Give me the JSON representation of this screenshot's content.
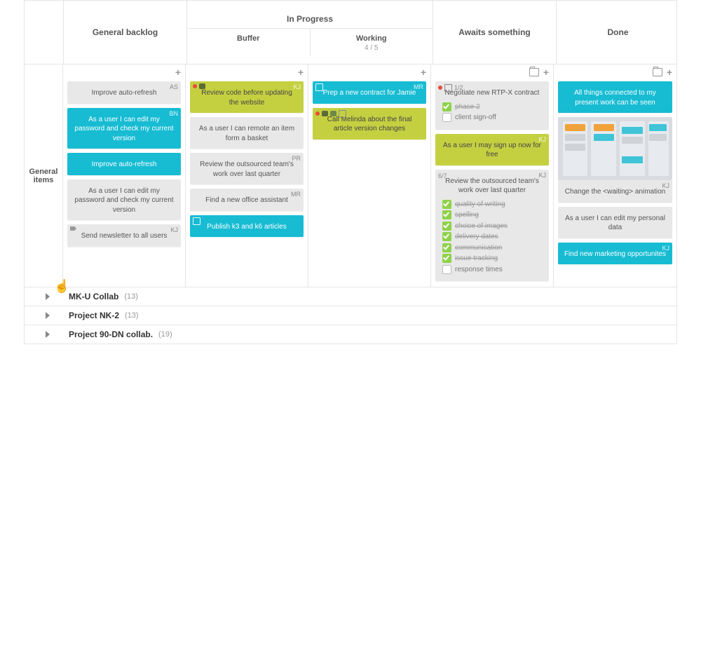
{
  "columns": {
    "backlog": "General backlog",
    "inprogress": "In Progress",
    "buffer": "Buffer",
    "working": "Working",
    "working_limit": "4 / 5",
    "awaits": "Awaits something",
    "done": "Done"
  },
  "row_label": "General items",
  "backlog": {
    "c1": {
      "assignee": "AS",
      "text": "Improve auto-refresh"
    },
    "c2": {
      "assignee": "BN",
      "text": "As a user I can edit my password and check my current version"
    },
    "c3": {
      "text": "Improve auto-refresh"
    },
    "c4": {
      "text": "As a user I can edit my password and check my current version"
    },
    "c5": {
      "assignee": "KJ",
      "text": "Send newsletter to all users"
    }
  },
  "buffer": {
    "c1": {
      "assignee": "KJ",
      "text": "Review code before updating the website"
    },
    "c2": {
      "text": "As a user I can remote an item form a basket"
    },
    "c3": {
      "assignee": "PR",
      "text": "Review the outsourced team's work over last quarter"
    },
    "c4": {
      "assignee": "MR",
      "text": "Find a new office assistant"
    },
    "c5": {
      "text": "Publish k3 and k6 articles"
    }
  },
  "working": {
    "c1": {
      "assignee": "MR",
      "text": "Prep a new contract for Jamie"
    },
    "c2": {
      "text": "Call Melinda about the final article version changes"
    }
  },
  "awaits": {
    "c1": {
      "count": "1/2",
      "text": "Negotiate new RTP-X contract",
      "items": [
        {
          "done": true,
          "label": "phase 2"
        },
        {
          "done": false,
          "label": "client sign-off"
        }
      ]
    },
    "c2": {
      "assignee": "KJ",
      "text": "As a user I may sign up now for free"
    },
    "c3": {
      "count": "6/7",
      "assignee": "KJ",
      "text": "Review the outsourced team's work over last quarter",
      "items": [
        {
          "done": true,
          "label": "quality of writing"
        },
        {
          "done": true,
          "label": "spelling"
        },
        {
          "done": true,
          "label": "choice of images"
        },
        {
          "done": true,
          "label": "delivery dates"
        },
        {
          "done": true,
          "label": "communication"
        },
        {
          "done": true,
          "label": "issue tracking"
        },
        {
          "done": false,
          "label": "response times"
        }
      ]
    }
  },
  "done": {
    "c1": {
      "text": "All things connected to my present work can be seen"
    },
    "c2": {
      "assignee": "KJ",
      "text": "Change the <waiting> animation"
    },
    "c3": {
      "text": "As a user I can edit my personal data"
    },
    "c4": {
      "assignee": "KJ",
      "text": "Find new marketing opportunites"
    }
  },
  "collapsed": {
    "r1": {
      "name": "MK-U Collab",
      "count": "(13)"
    },
    "r2": {
      "name": "Project NK-2",
      "count": "(13)"
    },
    "r3": {
      "name": "Project 90-DN collab.",
      "count": "(19)"
    }
  }
}
